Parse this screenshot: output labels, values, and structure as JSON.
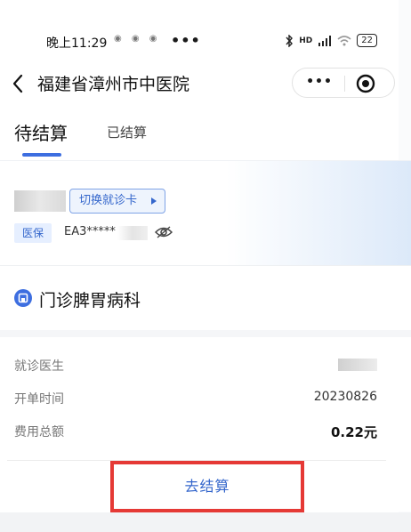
{
  "status_bar": {
    "time": "晚上11:29",
    "app_icons": "◉ ◉ ◉",
    "more": "•••",
    "network": "HD",
    "battery": "22"
  },
  "nav": {
    "title": "福建省漳州市中医院",
    "capsule_more": "•••"
  },
  "tabs": [
    {
      "label": "待结算",
      "active": true
    },
    {
      "label": "已结算",
      "active": false
    }
  ],
  "card": {
    "switch_label": "切换就诊卡",
    "insurance_badge": "医保",
    "card_number": "EA3*****"
  },
  "department": {
    "name": "门诊脾胃病科"
  },
  "info": {
    "doctor_label": "就诊医生",
    "order_time_label": "开单时间",
    "order_time_value": "20230826",
    "total_label": "费用总额",
    "total_value": "0.22元"
  },
  "actions": {
    "settle_label": "去结算"
  },
  "colors": {
    "accent": "#3567cc",
    "highlight_border": "#e53935",
    "tab_indicator": "#3d6ee0"
  }
}
